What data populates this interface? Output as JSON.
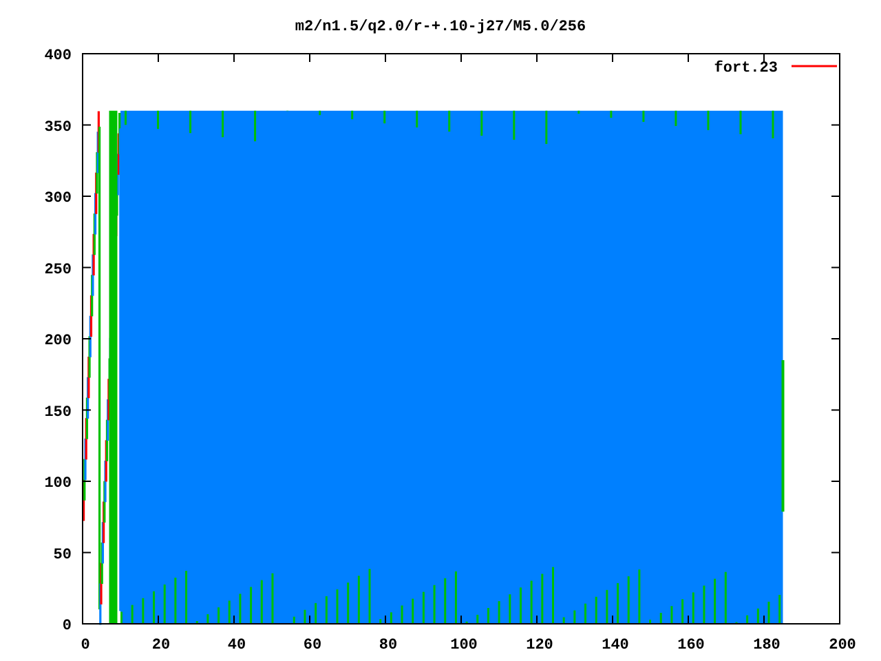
{
  "title": "m2/n1.5/q2.0/r-+.10-j27/M5.0/256",
  "legend": [
    {
      "label": "fort.23"
    }
  ],
  "x_axis": {
    "ticks": [
      "0",
      "20",
      "40",
      "60",
      "80",
      "100",
      "120",
      "140",
      "160",
      "180",
      "200"
    ]
  },
  "y_axis": {
    "ticks": [
      "400",
      "350",
      "300",
      "250",
      "200",
      "150",
      "100",
      "50",
      "0"
    ]
  }
}
